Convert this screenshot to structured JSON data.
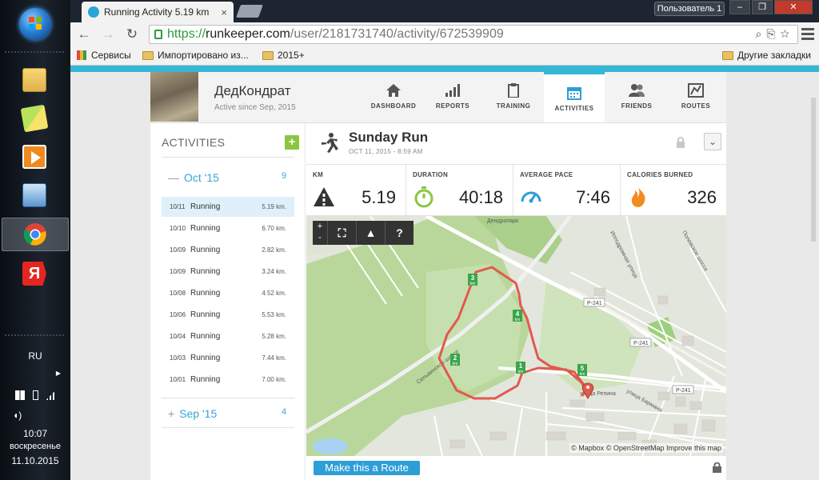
{
  "taskbar": {
    "lang": "RU",
    "time": "10:07",
    "weekday": "воскресенье",
    "date": "11.10.2015",
    "apps": [
      "file-explorer-icon",
      "sticky-notes-icon",
      "media-player-icon",
      "network-icon",
      "chrome-icon",
      "yandex-icon"
    ]
  },
  "browser": {
    "tab_title": "Running Activity 5.19 km",
    "user_button": "Пользователь 1",
    "url_scheme": "https://",
    "url_host": "runkeeper.com",
    "url_path": "/user/2181731740/activity/672539909",
    "bookmarks": {
      "apps": "Сервисы",
      "imported": "Импортировано из...",
      "folder_2015": "2015+",
      "other": "Другие закладки"
    }
  },
  "profile": {
    "name": "ДедКондрат",
    "since": "Active since Sep, 2015"
  },
  "nav": [
    {
      "label": "DASHBOARD",
      "icon": "home-icon"
    },
    {
      "label": "REPORTS",
      "icon": "bars-icon"
    },
    {
      "label": "TRAINING",
      "icon": "clipboard-icon"
    },
    {
      "label": "ACTIVITIES",
      "icon": "calendar-icon",
      "active": true
    },
    {
      "label": "FRIENDS",
      "icon": "people-icon"
    },
    {
      "label": "ROUTES",
      "icon": "route-icon"
    }
  ],
  "sidebar": {
    "title": "ACTIVITIES",
    "add_label": "+",
    "month_current": {
      "label": "Oct '15",
      "count": "9",
      "toggle": "—"
    },
    "activities": [
      {
        "date": "10/11",
        "type": "Running",
        "km": "5.19 km."
      },
      {
        "date": "10/10",
        "type": "Running",
        "km": "6.70 km."
      },
      {
        "date": "10/09",
        "type": "Running",
        "km": "2.82 km."
      },
      {
        "date": "10/09",
        "type": "Running",
        "km": "3.24 km."
      },
      {
        "date": "10/08",
        "type": "Running",
        "km": "4.52 km."
      },
      {
        "date": "10/06",
        "type": "Running",
        "km": "5.53 km."
      },
      {
        "date": "10/04",
        "type": "Running",
        "km": "5.28 km."
      },
      {
        "date": "10/03",
        "type": "Running",
        "km": "7.44 km."
      },
      {
        "date": "10/01",
        "type": "Running",
        "km": "7.00 km."
      }
    ],
    "month_prev": {
      "label": "Sep '15",
      "count": "4",
      "toggle": "+"
    }
  },
  "activity": {
    "title": "Sunday Run",
    "date": "OCT 11, 2015 - 8:59 AM",
    "stats": [
      {
        "label": "KM",
        "value": "5.19",
        "icon": "distance-icon"
      },
      {
        "label": "DURATION",
        "value": "40:18",
        "icon": "stopwatch-icon"
      },
      {
        "label": "AVERAGE PACE",
        "value": "7:46",
        "icon": "speedometer-icon"
      },
      {
        "label": "CALORIES BURNED",
        "value": "326",
        "icon": "flame-icon"
      }
    ]
  },
  "map": {
    "zoom_in": "+",
    "zoom_out": "-",
    "help": "?",
    "attribution": "© Mapbox © OpenStreetMap Improve this map",
    "labels": {
      "road1": "Сельвинское шоссе",
      "road2": "Ипподромная улица",
      "road3": "улица Репина",
      "road4": "улица Бармана",
      "road5": "Полевское шоссе",
      "park": "Дендропарк",
      "p241": "P-241"
    },
    "km_markers": [
      "1",
      "2",
      "3",
      "4",
      "5"
    ],
    "km_unit": "km",
    "route_button": "Make this a Route"
  },
  "colors": {
    "accent": "#35b7d6",
    "route": "#e05a4f",
    "green": "#8ac640",
    "stat_icon_grey": "#333",
    "stat_icon_green": "#8ac640",
    "stat_icon_blue": "#2e9ed6",
    "stat_icon_orange": "#f28c1e"
  }
}
